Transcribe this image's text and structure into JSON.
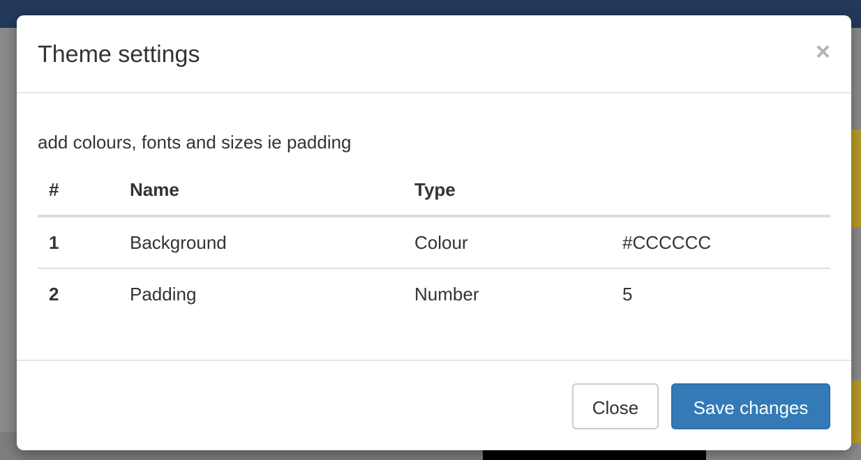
{
  "colors": {
    "topbar": "#22395a",
    "primary_button": "#337ab7",
    "close_icon": "#b4b4b4"
  },
  "modal": {
    "title": "Theme settings",
    "close_icon": "×",
    "description": "add colours, fonts and sizes ie padding",
    "table": {
      "headers": [
        "#",
        "Name",
        "Type",
        ""
      ],
      "rows": [
        {
          "index": "1",
          "name": "Background",
          "type": "Colour",
          "value": "#CCCCCC"
        },
        {
          "index": "2",
          "name": "Padding",
          "type": "Number",
          "value": "5"
        }
      ]
    },
    "footer": {
      "close_label": "Close",
      "save_label": "Save changes"
    }
  }
}
